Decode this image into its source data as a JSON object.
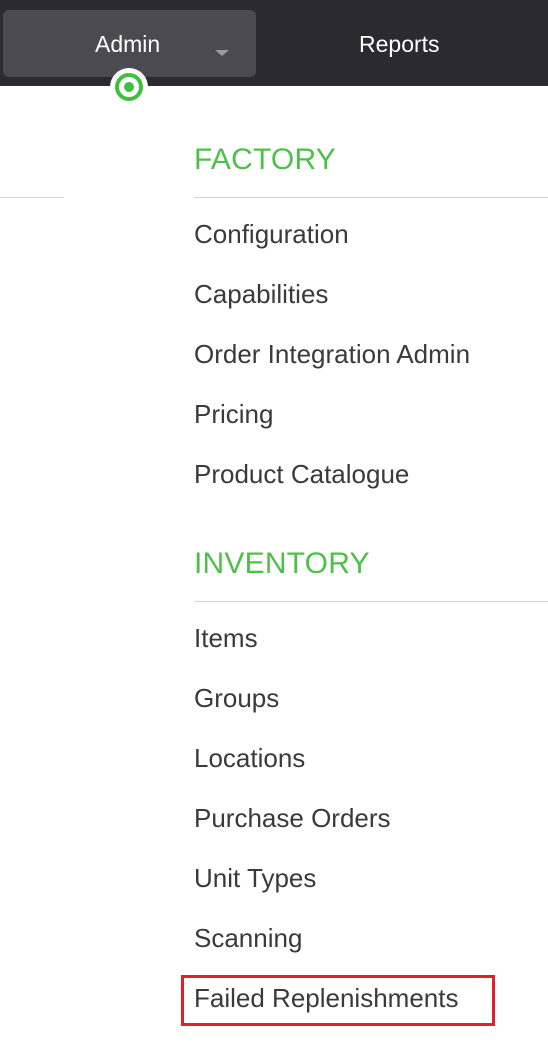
{
  "topnav": {
    "admin_label": "Admin",
    "reports_label": "Reports",
    "active_color": "#3fbf3f"
  },
  "menu": {
    "sections": [
      {
        "title": "FACTORY",
        "items": [
          "Configuration",
          "Capabilities",
          "Order Integration Admin",
          "Pricing",
          "Product Catalogue"
        ]
      },
      {
        "title": "INVENTORY",
        "items": [
          "Items",
          "Groups",
          "Locations",
          "Purchase Orders",
          "Unit Types",
          "Scanning",
          "Failed Replenishments"
        ]
      }
    ],
    "highlighted_item": "Failed Replenishments",
    "highlight_color": "#e0202a",
    "section_title_color": "#4ec04a"
  }
}
